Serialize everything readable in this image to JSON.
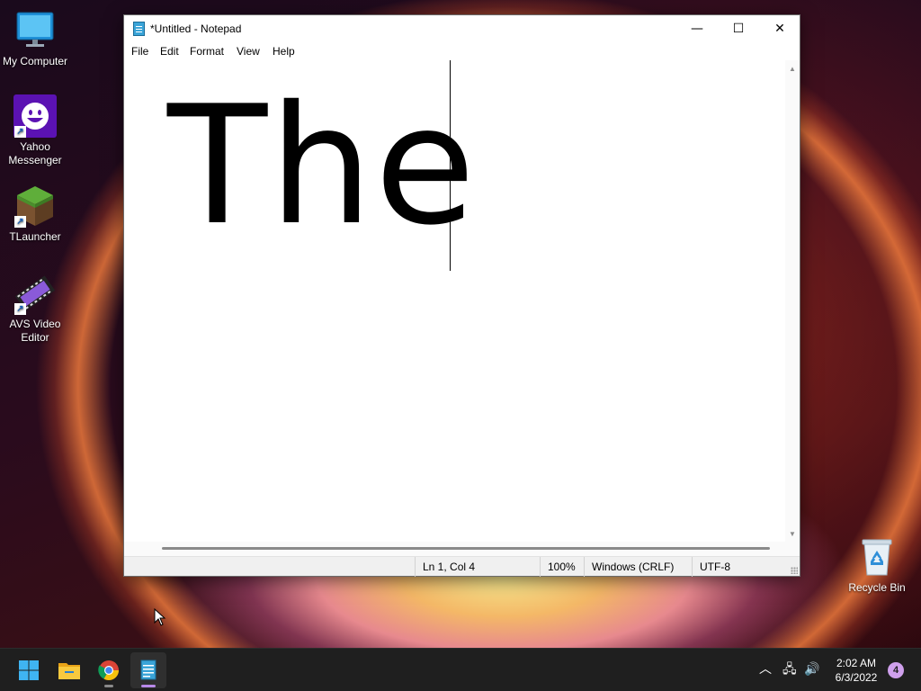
{
  "desktop": {
    "icons": [
      {
        "label": "My Computer"
      },
      {
        "label": "Yahoo Messenger"
      },
      {
        "label": "TLauncher"
      },
      {
        "label": "AVS Video Editor"
      },
      {
        "label": "Recycle Bin"
      }
    ]
  },
  "window": {
    "title": "*Untitled - Notepad",
    "controls": {
      "minimize": "—",
      "maximize": "☐",
      "close": "✕"
    },
    "menu": [
      "File",
      "Edit",
      "Format",
      "View",
      "Help"
    ],
    "editor_text": "The",
    "status": {
      "position": "Ln 1, Col 4",
      "zoom": "100%",
      "line_ending": "Windows (CRLF)",
      "encoding": "UTF-8"
    }
  },
  "taskbar": {
    "time": "2:02 AM",
    "date": "6/3/2022",
    "notification_count": "4",
    "tray": {
      "chevron": "︿",
      "network": "🖧",
      "volume": "🔊"
    }
  }
}
